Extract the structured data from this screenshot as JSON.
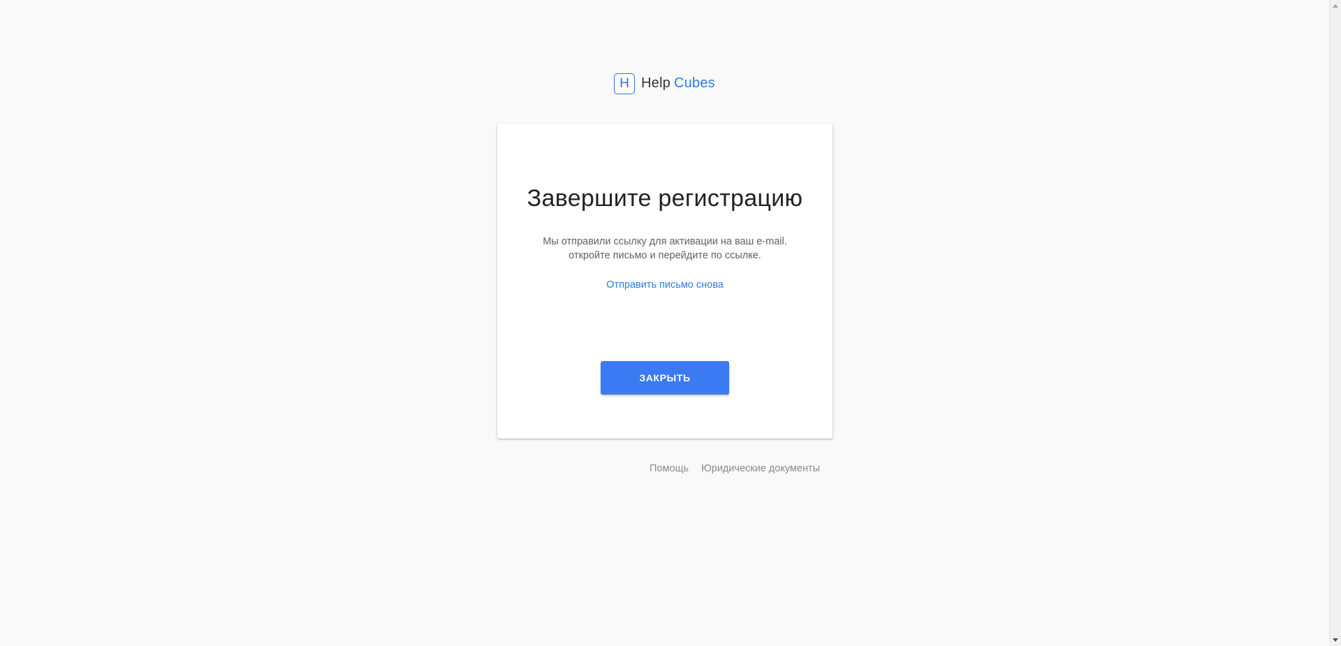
{
  "logo": {
    "mark": "H",
    "word_help": "Help",
    "word_cubes": "Cubes",
    "accent_color": "#2f7ae5"
  },
  "card": {
    "title": "Завершите регистрацию",
    "message_line1": "Мы отправили ссылку для активации на ваш e-mail.",
    "message_line2": "откройте письмо и перейдите по ссылке.",
    "resend_link": "Отправить письмо снова",
    "close_button": "ЗАКРЫТЬ",
    "button_color": "#3a7af2"
  },
  "footer": {
    "help_link": "Помощь",
    "legal_link": "Юридические документы"
  },
  "scrollbar": {
    "up_icon": "scroll-up-arrow-icon",
    "down_icon": "scroll-down-arrow-icon"
  }
}
